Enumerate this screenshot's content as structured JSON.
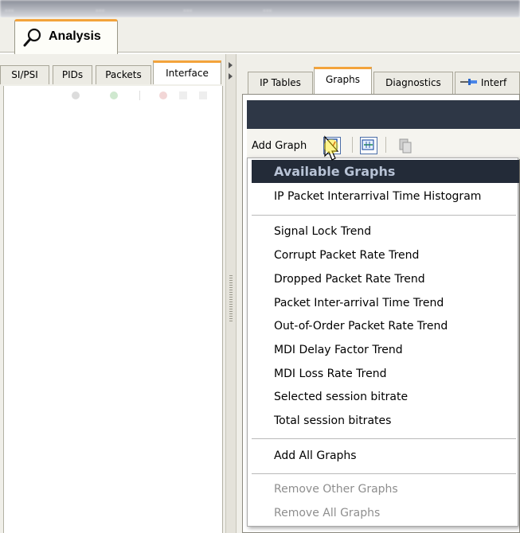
{
  "window": {
    "top_tabs": [
      "...",
      "...",
      "...",
      "..."
    ]
  },
  "main_tab": {
    "label": "Analysis"
  },
  "left_panel": {
    "tabs": [
      "SI/PSI",
      "PIDs",
      "Packets",
      "Interface"
    ],
    "active_tab": "Interface"
  },
  "right_panel": {
    "tabs": [
      "IP Tables",
      "Graphs",
      "Diagnostics",
      "Interf"
    ],
    "active_tab": "Graphs",
    "toolbar": {
      "add_graph_label": "Add Graph"
    }
  },
  "menu": {
    "header": "Available Graphs",
    "group1": [
      "IP Packet Interarrival Time Histogram"
    ],
    "group2": [
      "Signal Lock Trend",
      "Corrupt Packet Rate Trend",
      "Dropped Packet Rate Trend",
      "Packet Inter-arrival Time Trend",
      "Out-of-Order Packet Rate Trend",
      "MDI Delay Factor Trend",
      "MDI Loss Rate Trend",
      "Selected session bitrate",
      "Total session bitrates"
    ],
    "group3": [
      "Add All Graphs"
    ],
    "group4_disabled": [
      "Remove Other Graphs",
      "Remove All Graphs"
    ]
  },
  "colors": {
    "accent_tab": "#f3a33b",
    "menu_header_bg": "#232b38",
    "dark_bar": "#2e3746"
  },
  "icons": [
    "magnifier-icon",
    "add-graph-icon",
    "chart-icon",
    "copy-icon",
    "pin-icon",
    "pointer-cursor-icon"
  ]
}
